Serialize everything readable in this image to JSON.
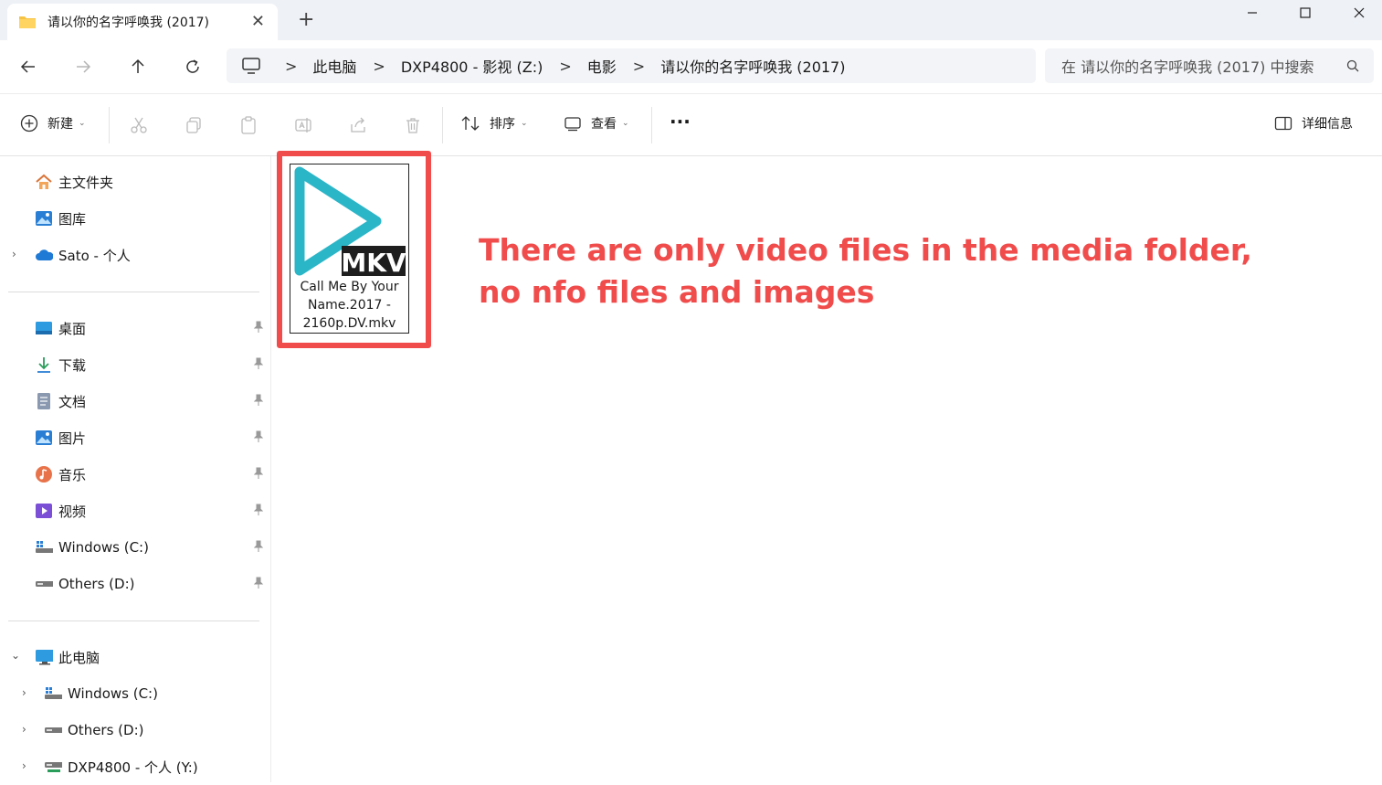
{
  "window": {
    "tab_title": "请以你的名字呼唤我 (2017)",
    "tab_close": "✕",
    "new_tab": "+"
  },
  "address": {
    "crumbs": [
      "此电脑",
      "DXP4800 - 影视 (Z:)",
      "电影",
      "请以你的名字呼唤我 (2017)"
    ],
    "separator": ">",
    "search_placeholder": "在 请以你的名字呼唤我 (2017) 中搜索"
  },
  "toolbar": {
    "new_label": "新建",
    "sort_label": "排序",
    "view_label": "查看",
    "more_label": "···",
    "details_label": "详细信息"
  },
  "sidebar": {
    "top_items": [
      {
        "label": "主文件夹",
        "icon": "home-icon"
      },
      {
        "label": "图库",
        "icon": "gallery-icon"
      },
      {
        "label": "Sato - 个人",
        "icon": "onedrive-cloud-icon"
      }
    ],
    "pinned_items": [
      {
        "label": "桌面",
        "icon": "desktop-icon"
      },
      {
        "label": "下载",
        "icon": "download-icon"
      },
      {
        "label": "文档",
        "icon": "documents-icon"
      },
      {
        "label": "图片",
        "icon": "pictures-icon"
      },
      {
        "label": "音乐",
        "icon": "music-icon"
      },
      {
        "label": "视频",
        "icon": "videos-icon"
      },
      {
        "label": "Windows (C:)",
        "icon": "windows-drive-icon"
      },
      {
        "label": "Others (D:)",
        "icon": "drive-icon"
      }
    ],
    "pc_items": [
      {
        "label": "此电脑",
        "icon": "computer-icon"
      },
      {
        "label": "Windows (C:)",
        "icon": "windows-drive-icon"
      },
      {
        "label": "Others (D:)",
        "icon": "drive-icon"
      },
      {
        "label": "DXP4800 - 个人 (Y:)",
        "icon": "network-drive-icon"
      }
    ]
  },
  "content": {
    "file": {
      "badge": "MKV",
      "name_lines": [
        "Call Me By Your",
        "Name.2017 -",
        "2160p.DV.mkv"
      ]
    },
    "annotation_lines": [
      "There are only video files in the media folder,",
      "no nfo files and images"
    ]
  },
  "colors": {
    "accent_red": "#f04c4c",
    "play_teal": "#2bb6c8",
    "chrome_bg": "#eef1f6"
  }
}
